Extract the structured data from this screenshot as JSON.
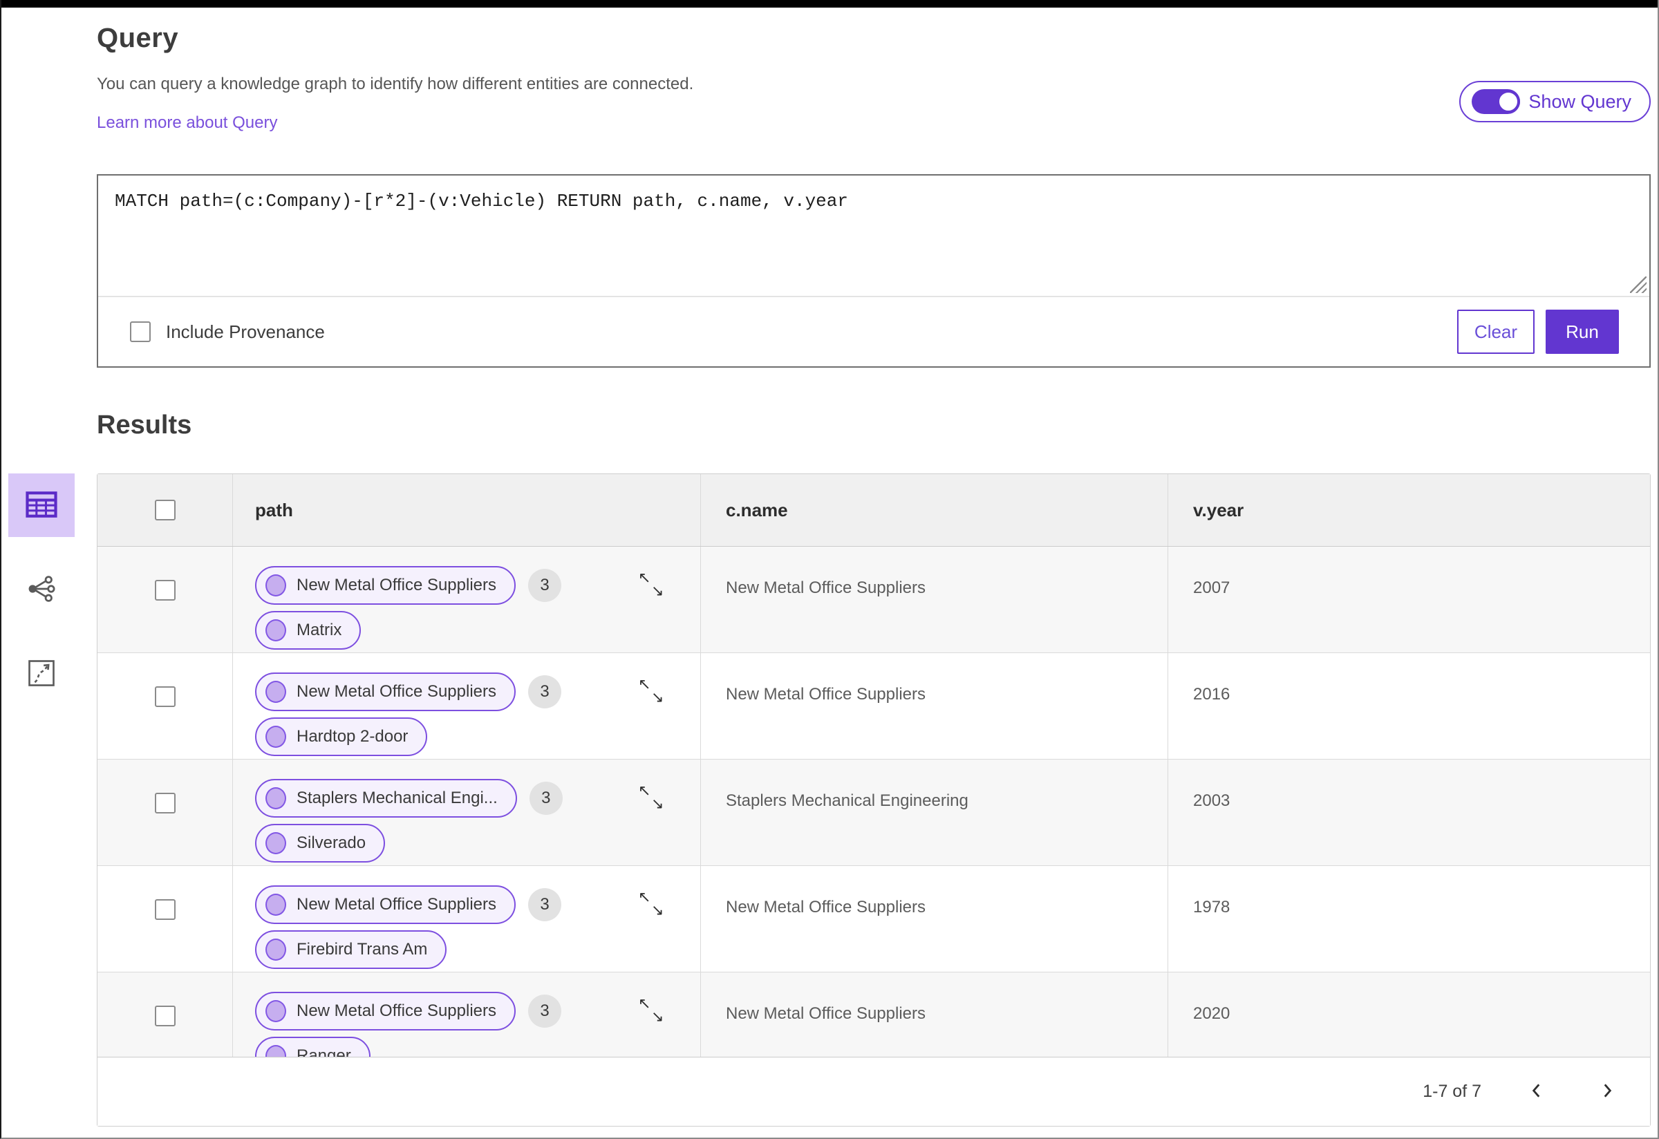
{
  "colors": {
    "accent": "#6236d0",
    "link": "#7a50dc",
    "pill_border": "#7d4fe0",
    "pill_background": "#f5f1fd",
    "node_dot": "#c6aeef",
    "selected_view_background": "#d9c8f8",
    "table_header_background": "#f0f0f0",
    "row_alternate_background": "#f7f7f7",
    "badge_background": "#e2e2e2"
  },
  "icons": {
    "expand_nw": "↖",
    "expand_se": "↘",
    "view_switcher": [
      "table-view-icon",
      "graph-view-icon",
      "route-view-icon"
    ]
  },
  "header": {
    "title": "Query",
    "description": "You can query a knowledge graph to identify how different entities are connected.",
    "learn_more": "Learn more about Query",
    "show_query_label": "Show Query",
    "show_query_state": "on"
  },
  "query_panel": {
    "query_text": "MATCH path=(c:Company)-[r*2]-(v:Vehicle) RETURN path, c.name, v.year",
    "include_provenance_label": "Include Provenance",
    "include_provenance_checked": false,
    "clear_label": "Clear",
    "run_label": "Run"
  },
  "results": {
    "title": "Results",
    "columns": {
      "path": "path",
      "c_name": "c.name",
      "v_year": "v.year"
    },
    "rows": [
      {
        "node1": "New Metal Office Suppliers",
        "node1_badge": "3",
        "node2": "Matrix",
        "c_name": "New Metal Office Suppliers",
        "v_year": "2007"
      },
      {
        "node1": "New Metal Office Suppliers",
        "node1_badge": "3",
        "node2": "Hardtop 2-door",
        "c_name": "New Metal Office Suppliers",
        "v_year": "2016"
      },
      {
        "node1": "Staplers Mechanical Engi...",
        "node1_badge": "3",
        "node2": "Silverado",
        "c_name": "Staplers Mechanical Engineering",
        "v_year": "2003"
      },
      {
        "node1": "New Metal Office Suppliers",
        "node1_badge": "3",
        "node2": "Firebird Trans Am",
        "c_name": "New Metal Office Suppliers",
        "v_year": "1978"
      },
      {
        "node1": "New Metal Office Suppliers",
        "node1_badge": "3",
        "node2": "Ranger",
        "c_name": "New Metal Office Suppliers",
        "v_year": "2020"
      }
    ],
    "pagination": {
      "range_label": "1-7 of 7"
    }
  }
}
